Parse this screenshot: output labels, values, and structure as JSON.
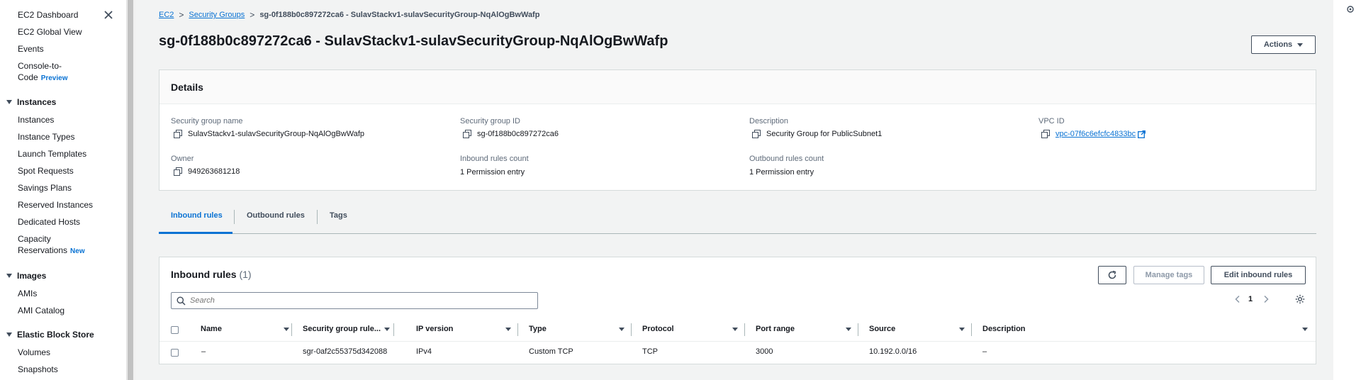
{
  "sidebar": {
    "top_links": [
      "EC2 Dashboard",
      "EC2 Global View",
      "Events"
    ],
    "console_to_code": {
      "label": "Console-to-Code",
      "badge": "Preview"
    },
    "instances": {
      "title": "Instances",
      "items": [
        "Instances",
        "Instance Types",
        "Launch Templates",
        "Spot Requests",
        "Savings Plans",
        "Reserved Instances",
        "Dedicated Hosts"
      ],
      "capacity": {
        "label": "Capacity Reservations",
        "badge": "New"
      }
    },
    "images": {
      "title": "Images",
      "items": [
        "AMIs",
        "AMI Catalog"
      ]
    },
    "ebs": {
      "title": "Elastic Block Store",
      "items": [
        "Volumes",
        "Snapshots"
      ]
    }
  },
  "breadcrumb": {
    "ec2": "EC2",
    "security_groups": "Security Groups",
    "current": "sg-0f188b0c897272ca6 - SulavStackv1-sulavSecurityGroup-NqAlOgBwWafp"
  },
  "page_title": "sg-0f188b0c897272ca6 - SulavStackv1-sulavSecurityGroup-NqAlOgBwWafp",
  "actions_label": "Actions",
  "details": {
    "title": "Details",
    "fields": {
      "sg_name": {
        "label": "Security group name",
        "value": "SulavStackv1-sulavSecurityGroup-NqAlOgBwWafp"
      },
      "sg_id": {
        "label": "Security group ID",
        "value": "sg-0f188b0c897272ca6"
      },
      "description": {
        "label": "Description",
        "value": "Security Group for PublicSubnet1"
      },
      "vpc_id": {
        "label": "VPC ID",
        "value": "vpc-07f6c6efcfc4833bc"
      },
      "owner": {
        "label": "Owner",
        "value": "949263681218"
      },
      "inbound_count": {
        "label": "Inbound rules count",
        "value": "1 Permission entry"
      },
      "outbound_count": {
        "label": "Outbound rules count",
        "value": "1 Permission entry"
      }
    }
  },
  "tabs": [
    "Inbound rules",
    "Outbound rules",
    "Tags"
  ],
  "rules": {
    "title": "Inbound rules",
    "count": "(1)",
    "manage_tags": "Manage tags",
    "edit": "Edit inbound rules",
    "search_placeholder": "Search",
    "page": "1",
    "columns": [
      "Name",
      "Security group rule...",
      "IP version",
      "Type",
      "Protocol",
      "Port range",
      "Source",
      "Description"
    ],
    "rows": [
      [
        "–",
        "sgr-0af2c55375d342088",
        "IPv4",
        "Custom TCP",
        "TCP",
        "3000",
        "10.192.0.0/16",
        "–"
      ]
    ]
  },
  "colors": {
    "link": "#0972d3",
    "background": "#f2f3f3"
  }
}
